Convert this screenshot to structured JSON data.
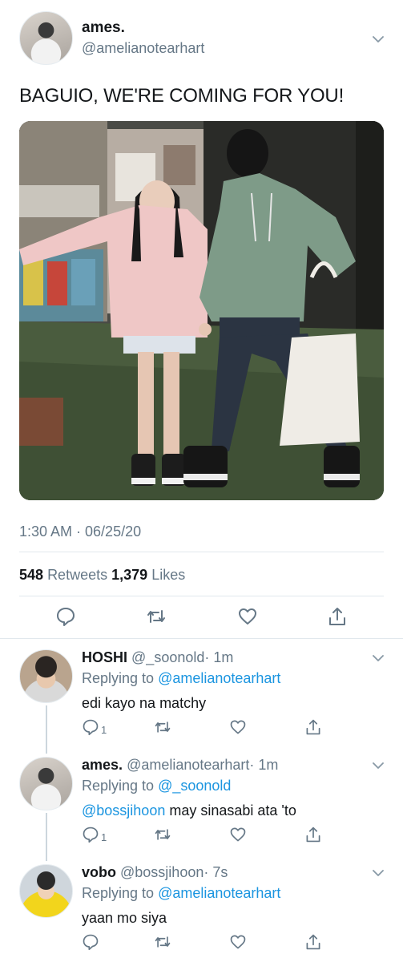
{
  "main_tweet": {
    "display_name": "ames.",
    "handle": "@amelianotearhart",
    "text": "BAGUIO, WE'RE COMING FOR YOU!",
    "timestamp": "1:30 AM · 06/25/20",
    "retweets_count": "548",
    "retweets_label": "Retweets",
    "likes_count": "1,379",
    "likes_label": "Likes",
    "icons": [
      "reply-icon",
      "retweet-icon",
      "like-icon",
      "share-icon",
      "chevron-down-icon"
    ]
  },
  "replies": [
    {
      "display_name": "HOSHI",
      "handle": "@_soonold",
      "time": "· 1m",
      "replying_prefix": "Replying to",
      "replying_to": "@amelianotearhart",
      "mention": "",
      "text": "edi kayo na matchy",
      "reply_count": "1"
    },
    {
      "display_name": "ames.",
      "handle": "@amelianotearhart",
      "time": "· 1m",
      "replying_prefix": "Replying to",
      "replying_to": "@_soonold",
      "mention": "@bossjihoon",
      "text": "may sinasabi ata 'to",
      "reply_count": "1"
    },
    {
      "display_name": "vobo",
      "handle": "@bossjihoon",
      "time": "· 7s",
      "replying_prefix": "Replying to",
      "replying_to": "@amelianotearhart",
      "mention": "",
      "text": "yaan mo siya",
      "reply_count": ""
    }
  ],
  "colors": {
    "link": "#1b95e0",
    "secondary_text": "#657786",
    "divider": "#e1e8ed",
    "thread_line": "#ccd6dd"
  }
}
